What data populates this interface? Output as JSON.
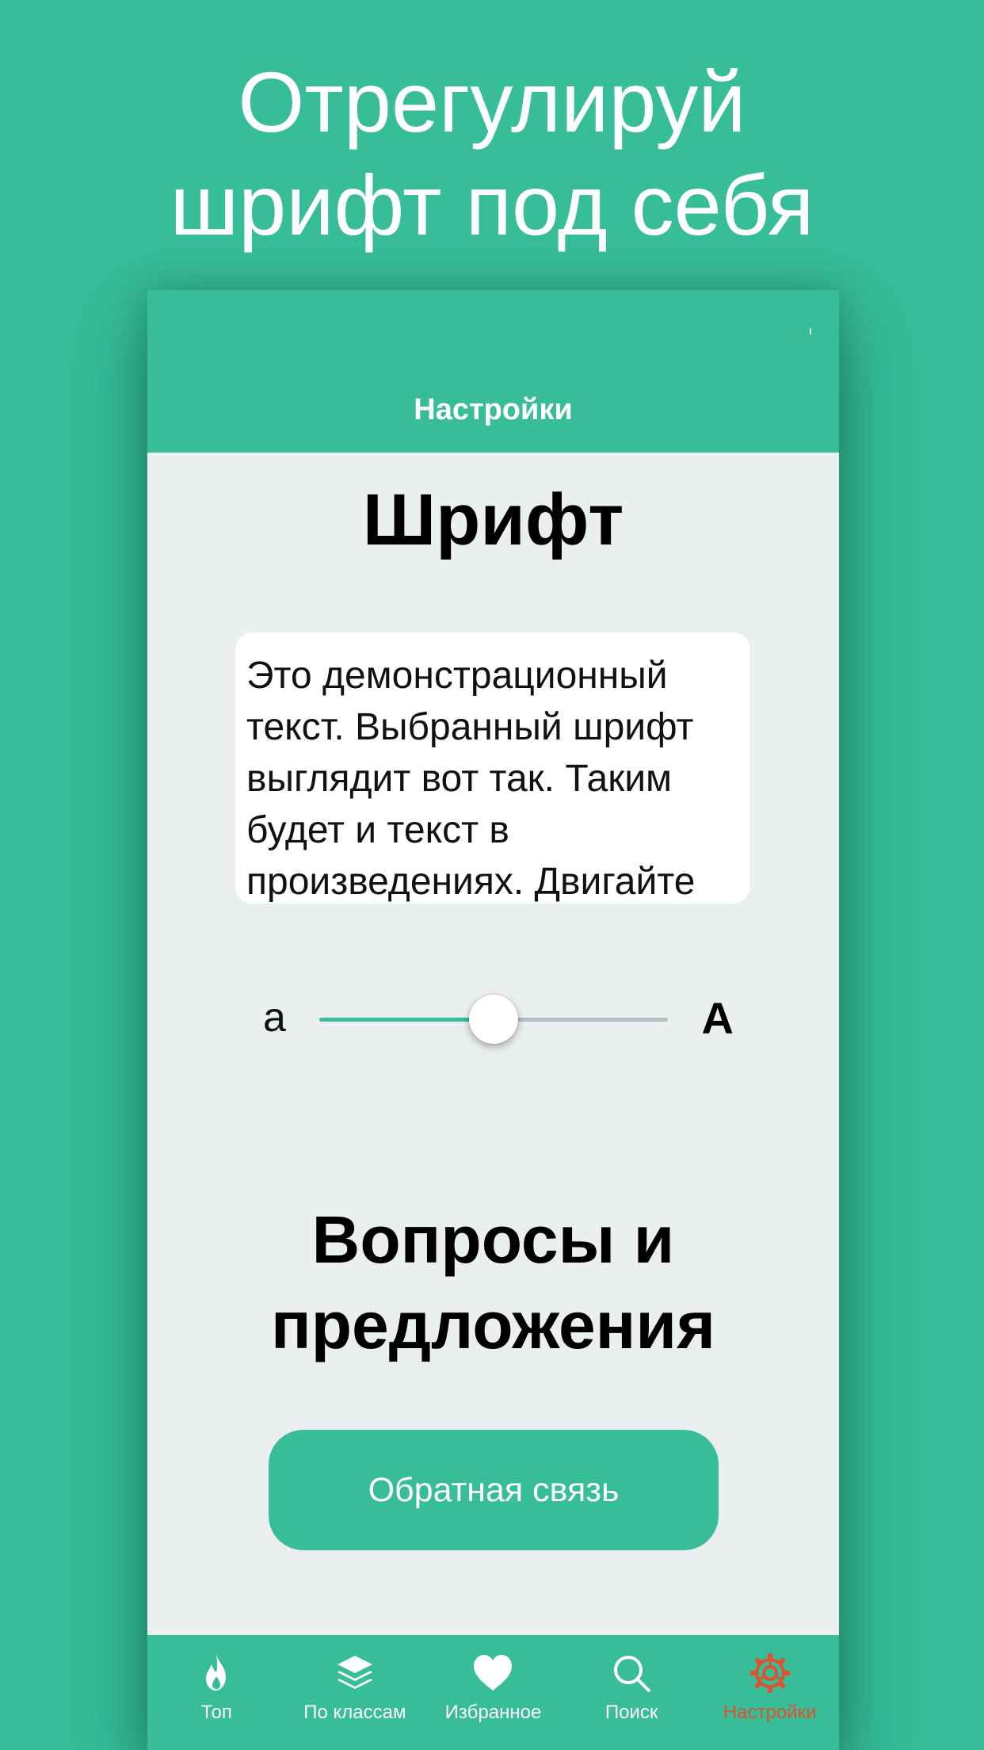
{
  "promo": {
    "line1": "Отрегулируй",
    "line2": "шрифт под себя"
  },
  "navbar": {
    "title": "Настройки"
  },
  "font_section": {
    "title": "Шрифт",
    "demo_text": "Это демонстрационный текст. Выбранный шрифт выглядит вот так. Таким будет и текст в произведениях. Двигайте",
    "slider": {
      "min_label": "а",
      "max_label": "А",
      "value_fraction": 0.5
    }
  },
  "feedback_section": {
    "title_line1": "Вопросы и",
    "title_line2": "предложения",
    "button_label": "Обратная связь"
  },
  "tabbar": {
    "items": [
      {
        "label": "Топ",
        "icon": "flame-icon"
      },
      {
        "label": "По классам",
        "icon": "layers-icon"
      },
      {
        "label": "Избранное",
        "icon": "heart-icon"
      },
      {
        "label": "Поиск",
        "icon": "search-icon"
      },
      {
        "label": "Настройки",
        "icon": "gear-icon",
        "active": true
      }
    ]
  },
  "colors": {
    "brand": "#37bd98",
    "active_tab": "#e0512f",
    "content_bg": "#eceff0"
  }
}
